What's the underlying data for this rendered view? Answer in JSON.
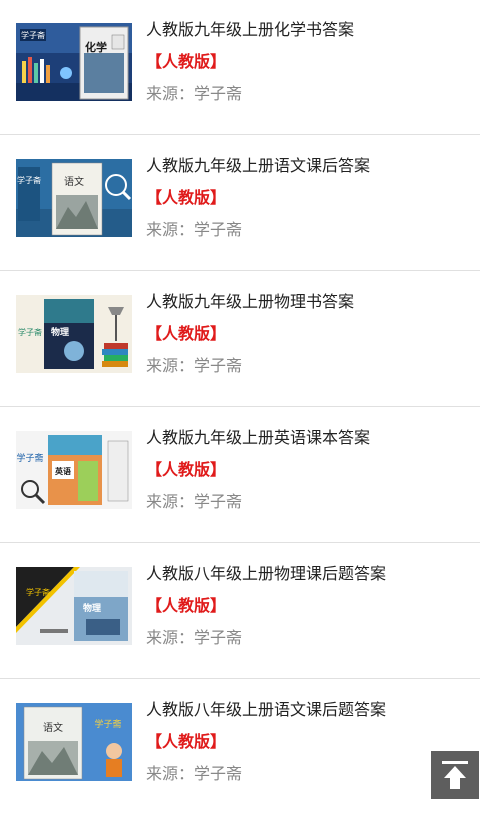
{
  "articles": [
    {
      "title": "人教版九年级上册化学书答案",
      "tag": "【人教版】",
      "source": "来源：学子斋",
      "thumb_icon": "chemistry-textbook-cover",
      "thumb_text": "化学",
      "thumb_brand": "学子斋"
    },
    {
      "title": "人教版九年级上册语文课后答案",
      "tag": "【人教版】",
      "source": "来源：学子斋",
      "thumb_icon": "chinese-textbook-cover",
      "thumb_text": "语文",
      "thumb_brand": "学子斋"
    },
    {
      "title": "人教版九年级上册物理书答案",
      "tag": "【人教版】",
      "source": "来源：学子斋",
      "thumb_icon": "physics-textbook-cover",
      "thumb_text": "物理",
      "thumb_brand": "学子斋"
    },
    {
      "title": "人教版九年级上册英语课本答案",
      "tag": "【人教版】",
      "source": "来源：学子斋",
      "thumb_icon": "english-textbook-cover",
      "thumb_text": "英语",
      "thumb_brand": "学子斋"
    },
    {
      "title": "人教版八年级上册物理课后题答案",
      "tag": "【人教版】",
      "source": "来源：学子斋",
      "thumb_icon": "physics-textbook-cover",
      "thumb_text": "物理",
      "thumb_brand": "学子斋"
    },
    {
      "title": "人教版八年级上册语文课后题答案",
      "tag": "【人教版】",
      "source": "来源：学子斋",
      "thumb_icon": "chinese-textbook-cover",
      "thumb_text": "语文",
      "thumb_brand": "学子斋"
    }
  ],
  "back_to_top": {
    "icon": "arrow-up-to-top-icon"
  },
  "colors": {
    "tag": "#e01b1b",
    "title": "#222222",
    "source": "#888888",
    "divider": "#e0e0e0",
    "back_to_top_bg": "#5e5e5e"
  }
}
